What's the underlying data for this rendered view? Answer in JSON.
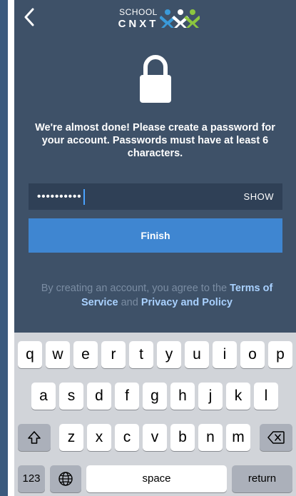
{
  "header": {
    "logo_line1": "SCHOOL",
    "logo_line2": "CNXT",
    "icons": {
      "back": "chevron-left-icon",
      "logo_mark": "people-logo-icon",
      "lock": "lock-icon"
    }
  },
  "message": "We're almost done! Please create a password for your account. Passwords must have at least 6 characters.",
  "password": {
    "masked_value": "••••••••••",
    "show_label": "SHOW"
  },
  "finish_label": "Finish",
  "terms": {
    "prefix": "By creating an account, you agree to the ",
    "terms_link": "Terms of Service",
    "middle": " and ",
    "privacy_link": "Privacy and Policy"
  },
  "keyboard": {
    "row1": [
      "q",
      "w",
      "e",
      "r",
      "t",
      "y",
      "u",
      "i",
      "o",
      "p"
    ],
    "row2": [
      "a",
      "s",
      "d",
      "f",
      "g",
      "h",
      "j",
      "k",
      "l"
    ],
    "row3": [
      "z",
      "x",
      "c",
      "v",
      "b",
      "n",
      "m"
    ],
    "numbers_label": "123",
    "space_label": "space",
    "return_label": "return",
    "icons": {
      "shift": "shift-icon",
      "delete": "delete-icon",
      "globe": "globe-icon"
    }
  },
  "colors": {
    "background": "#3e5168",
    "button": "#3f86d1",
    "link": "#a9d1ff",
    "keyboard": "#d1d4d9"
  }
}
